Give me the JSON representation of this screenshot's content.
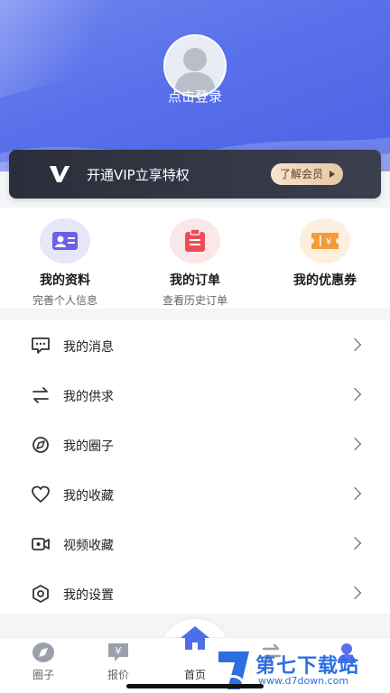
{
  "profile": {
    "login_text": "点击登录"
  },
  "vip": {
    "text": "开通VIP立享特权",
    "button": "了解会员"
  },
  "quick": [
    {
      "title": "我的资料",
      "sub": "完善个人信息",
      "icon": "id-card-icon"
    },
    {
      "title": "我的订单",
      "sub": "查看历史订单",
      "icon": "order-icon"
    },
    {
      "title": "我的优惠券",
      "sub": "",
      "icon": "coupon-icon"
    }
  ],
  "menu": [
    {
      "label": "我的消息",
      "icon": "message-icon"
    },
    {
      "label": "我的供求",
      "icon": "exchange-icon"
    },
    {
      "label": "我的圈子",
      "icon": "circle-icon"
    },
    {
      "label": "我的收藏",
      "icon": "heart-icon"
    },
    {
      "label": "视频收藏",
      "icon": "video-icon"
    },
    {
      "label": "我的设置",
      "icon": "settings-icon"
    }
  ],
  "tabs": [
    {
      "label": "圈子",
      "icon": "compass-icon"
    },
    {
      "label": "报价",
      "icon": "price-icon"
    },
    {
      "label": "首页",
      "icon": "home-icon"
    },
    {
      "label": "",
      "icon": "swap-icon"
    },
    {
      "label": "",
      "icon": "user-icon"
    }
  ],
  "watermark": {
    "title": "第七下载站",
    "url": "www.d7down.com"
  },
  "colors": {
    "header": "#5870ea",
    "accent": "#4c63e4",
    "vip_gold": "#e6c7a5"
  }
}
